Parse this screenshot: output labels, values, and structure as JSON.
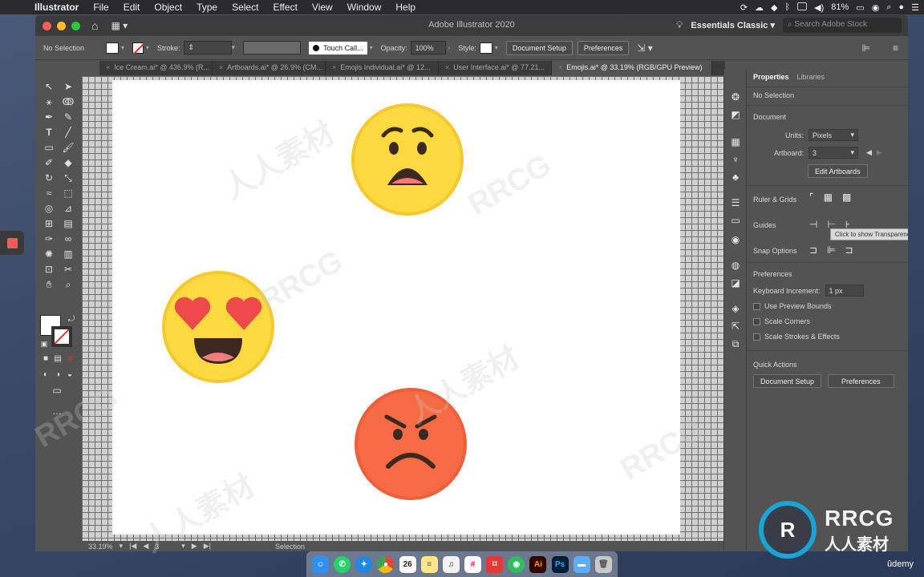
{
  "menubar": {
    "app_name": "Illustrator",
    "items": [
      "File",
      "Edit",
      "Object",
      "Type",
      "Select",
      "Effect",
      "View",
      "Window",
      "Help"
    ],
    "battery": "81%"
  },
  "window": {
    "title": "Adobe Illustrator 2020",
    "workspace": "Essentials Classic",
    "search_placeholder": "Search Adobe Stock"
  },
  "controlbar": {
    "selection": "No Selection",
    "stroke_label": "Stroke:",
    "brush": "Touch Call...",
    "opacity_label": "Opacity:",
    "opacity_value": "100%",
    "style_label": "Style:",
    "document_setup": "Document Setup",
    "preferences": "Preferences"
  },
  "tabs": [
    {
      "label": "Ice Cream.ai* @ 436.9% (R..."
    },
    {
      "label": "Artboards.ai* @ 26.9% (CM..."
    },
    {
      "label": "Emojis Individual.ai* @ 12..."
    },
    {
      "label": "User Interface.ai* @ 77.21..."
    },
    {
      "label": "Emojis.ai* @ 33.19% (RGB/GPU Preview)",
      "active": true
    }
  ],
  "statusbar": {
    "zoom": "33.19%",
    "artboard": "3",
    "tool": "Selection"
  },
  "panel": {
    "tab_properties": "Properties",
    "tab_libraries": "Libraries",
    "no_selection": "No Selection",
    "document_heading": "Document",
    "units_label": "Units:",
    "units_value": "Pixels",
    "artboard_label": "Artboard:",
    "artboard_value": "3",
    "edit_artboards": "Edit Artboards",
    "ruler_grids": "Ruler & Grids",
    "tooltip": "Click to show Transparency Grid",
    "guides": "Guides",
    "snap_options": "Snap Options",
    "preferences_heading": "Preferences",
    "keyboard_increment_label": "Keyboard Increment:",
    "keyboard_increment_value": "1 px",
    "use_preview_bounds": "Use Preview Bounds",
    "scale_corners": "Scale Corners",
    "scale_strokes": "Scale Strokes & Effects",
    "quick_actions": "Quick Actions",
    "document_setup_btn": "Document Setup",
    "preferences_btn": "Preferences"
  },
  "dock": {
    "calendar_day": "26",
    "ai_label": "Ai",
    "ps_label": "Ps"
  },
  "watermark": {
    "text": "RRCG",
    "text_cn": "人人素材",
    "udemy": "ûdemy"
  },
  "colors": {
    "emoji_yellow": "#fbd93f",
    "emoji_red": "#f56b44",
    "heart": "#ef4a4a",
    "mouth": "#3c2a20"
  }
}
